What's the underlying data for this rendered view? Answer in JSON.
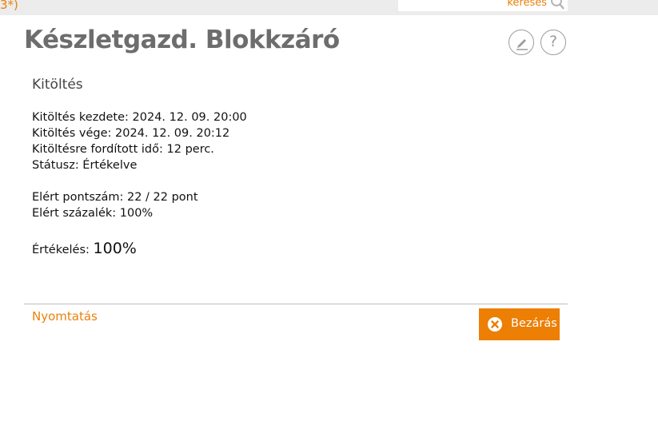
{
  "topbar": {
    "left_fragment": "3*)",
    "search": {
      "label": "keresés",
      "icon": "search-icon"
    }
  },
  "header": {
    "title": "Készletgazd. Blokkzáró",
    "edit_icon": "pencil-icon",
    "help_label": "?"
  },
  "section": {
    "title": "Kitöltés",
    "fields": [
      "Kitöltés kezdete: 2024. 12. 09. 20:00",
      "Kitöltés vége: 2024. 12. 09. 20:12",
      "Kitöltésre fordított idő: 12 perc.",
      "Státusz: Értékelve",
      "Elért pontszám: 22 / 22 pont",
      "Elért százalék: 100%"
    ],
    "rating_label": "Értékelés:",
    "rating_value": "100%"
  },
  "footer": {
    "print_label": "Nyomtatás",
    "close_label": "Bezárás",
    "close_icon": "close-circle-icon"
  },
  "colors": {
    "accent": "#ec7f04",
    "title": "#6d6d6d",
    "topbar_bg": "#ececec"
  }
}
